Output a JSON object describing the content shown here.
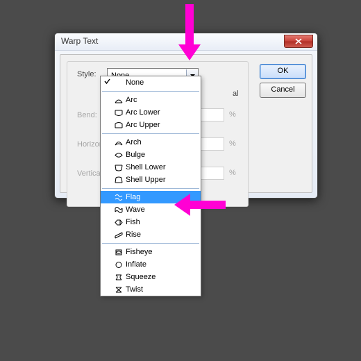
{
  "dialog": {
    "title": "Warp Text",
    "style_label": "Style:",
    "style_value": "None",
    "bend_label": "Bend:",
    "hdist_label": "Horizontal Distortion:",
    "vdist_label": "Vertical Distortion:",
    "vert_suffix": "al",
    "pct": "%",
    "ok": "OK",
    "cancel": "Cancel"
  },
  "dropdown": {
    "groups": [
      {
        "items": [
          {
            "label": "None",
            "checked": true,
            "icon": ""
          }
        ]
      },
      {
        "items": [
          {
            "label": "Arc",
            "icon": "arc"
          },
          {
            "label": "Arc Lower",
            "icon": "arclower"
          },
          {
            "label": "Arc Upper",
            "icon": "arcupper"
          }
        ]
      },
      {
        "items": [
          {
            "label": "Arch",
            "icon": "arch"
          },
          {
            "label": "Bulge",
            "icon": "bulge"
          },
          {
            "label": "Shell Lower",
            "icon": "shelllower"
          },
          {
            "label": "Shell Upper",
            "icon": "shellupper"
          }
        ]
      },
      {
        "items": [
          {
            "label": "Flag",
            "icon": "flag",
            "selected": true
          },
          {
            "label": "Wave",
            "icon": "wave"
          },
          {
            "label": "Fish",
            "icon": "fish"
          },
          {
            "label": "Rise",
            "icon": "rise"
          }
        ]
      },
      {
        "items": [
          {
            "label": "Fisheye",
            "icon": "fisheye"
          },
          {
            "label": "Inflate",
            "icon": "inflate"
          },
          {
            "label": "Squeeze",
            "icon": "squeeze"
          },
          {
            "label": "Twist",
            "icon": "twist"
          }
        ]
      }
    ]
  }
}
